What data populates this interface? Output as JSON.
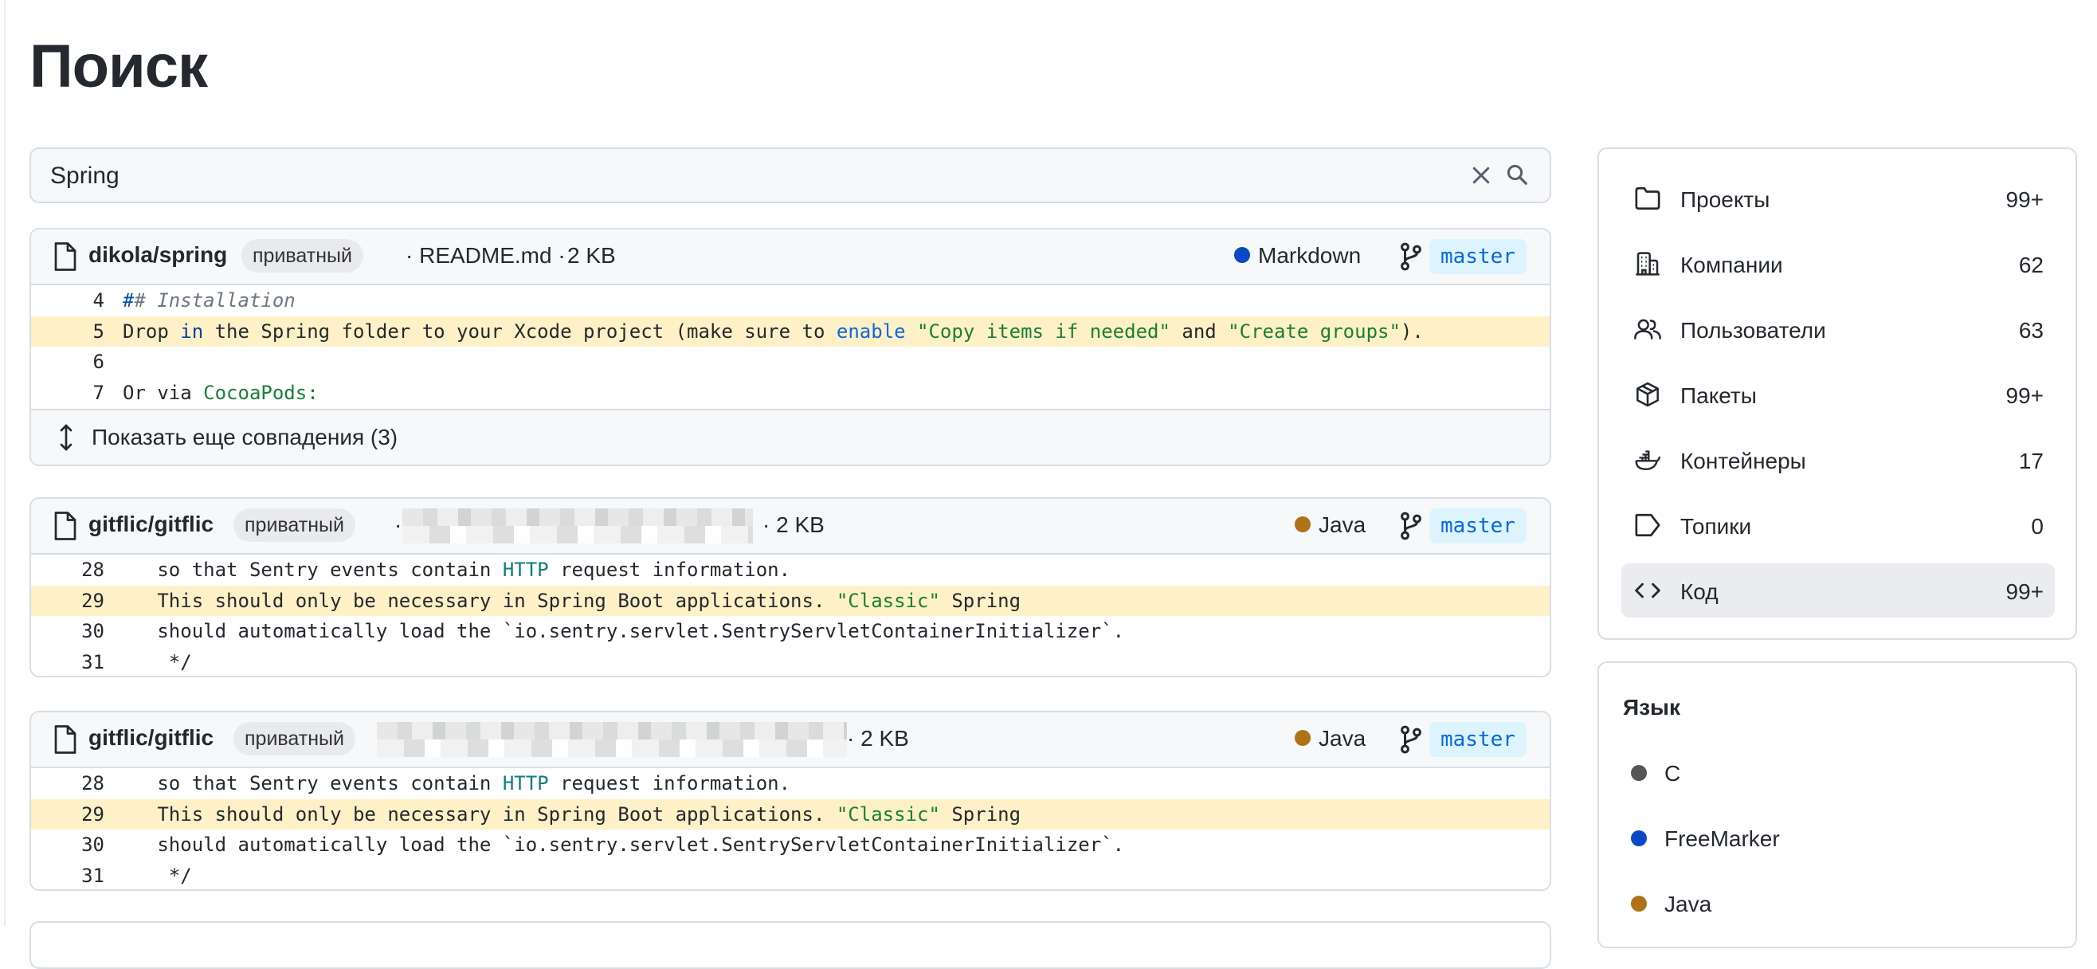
{
  "page": {
    "title": "Поиск"
  },
  "search": {
    "value": "Spring"
  },
  "results": [
    {
      "repo": "dikola/spring",
      "private": "приватный",
      "file": "· README.md ·",
      "size": "2 KB",
      "language": "Markdown",
      "language_color": "#0b47c7",
      "branch": "master",
      "lines": [
        {
          "n": "4",
          "parts": [
            [
              "hd",
              "#"
            ],
            [
              "cm",
              "# Installation"
            ]
          ]
        },
        {
          "n": "5",
          "hl": true,
          "parts": [
            [
              "",
              "Drop "
            ],
            [
              "kw",
              "in"
            ],
            [
              "",
              " the Spring folder to your Xcode project (make sure to "
            ],
            [
              "blue",
              "enable"
            ],
            [
              "",
              " "
            ],
            [
              "str",
              "\"Copy items if needed\""
            ],
            [
              "",
              " and "
            ],
            [
              "str",
              "\"Create groups\""
            ],
            [
              "",
              ")."
            ]
          ]
        },
        {
          "n": "6",
          "parts": []
        },
        {
          "n": "7",
          "parts": [
            [
              "",
              "Or via "
            ],
            [
              "str",
              "CocoaPods:"
            ]
          ]
        }
      ],
      "more": "Показать еще совпадения (3)"
    },
    {
      "repo": "gitflic/gitflic",
      "private": "приватный",
      "file": "·",
      "size": "· 2 KB",
      "language": "Java",
      "language_color": "#b07219",
      "branch": "master",
      "lines": [
        {
          "n": "28",
          "parts": [
            [
              "",
              "   so that Sentry events contain "
            ],
            [
              "teal",
              "HTTP"
            ],
            [
              "",
              " request information."
            ]
          ]
        },
        {
          "n": "29",
          "hl": true,
          "parts": [
            [
              "",
              "   This should only be necessary in Spring Boot applications. "
            ],
            [
              "str",
              "\"Classic\""
            ],
            [
              "",
              " Spring"
            ]
          ]
        },
        {
          "n": "30",
          "parts": [
            [
              "",
              "   should automatically load the `io.sentry.servlet.SentryServletContainerInitializer`."
            ]
          ]
        },
        {
          "n": "31",
          "parts": [
            [
              "",
              "    */"
            ]
          ]
        }
      ]
    },
    {
      "repo": "gitflic/gitflic",
      "private": "приватный",
      "file": "",
      "size": "· 2 KB",
      "language": "Java",
      "language_color": "#b07219",
      "branch": "master",
      "lines": [
        {
          "n": "28",
          "parts": [
            [
              "",
              "   so that Sentry events contain "
            ],
            [
              "teal",
              "HTTP"
            ],
            [
              "",
              " request information."
            ]
          ]
        },
        {
          "n": "29",
          "hl": true,
          "parts": [
            [
              "",
              "   This should only be necessary in Spring Boot applications. "
            ],
            [
              "str",
              "\"Classic\""
            ],
            [
              "",
              " Spring"
            ]
          ]
        },
        {
          "n": "30",
          "parts": [
            [
              "",
              "   should automatically load the `io.sentry.servlet.SentryServletContainerInitializer`."
            ]
          ]
        },
        {
          "n": "31",
          "parts": [
            [
              "",
              "    */"
            ]
          ]
        }
      ]
    }
  ],
  "sidebar": {
    "items": [
      {
        "label": "Проекты",
        "count": "99+",
        "icon": "folder-icon"
      },
      {
        "label": "Компании",
        "count": "62",
        "icon": "building-icon"
      },
      {
        "label": "Пользователи",
        "count": "63",
        "icon": "people-icon"
      },
      {
        "label": "Пакеты",
        "count": "99+",
        "icon": "package-icon"
      },
      {
        "label": "Контейнеры",
        "count": "17",
        "icon": "container-icon"
      },
      {
        "label": "Топики",
        "count": "0",
        "icon": "tag-icon"
      },
      {
        "label": "Код",
        "count": "99+",
        "icon": "code-icon",
        "active": true
      }
    ]
  },
  "languages": {
    "title": "Язык",
    "items": [
      {
        "label": "C",
        "color": "#555555"
      },
      {
        "label": "FreeMarker",
        "color": "#0b47c7"
      },
      {
        "label": "Java",
        "color": "#b07219"
      }
    ]
  }
}
